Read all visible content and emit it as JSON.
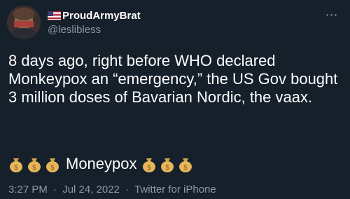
{
  "author": {
    "display_name": "ProudArmyBrat",
    "handle": "@leslibless",
    "flag_icon": "us-flag-icon"
  },
  "tweet": {
    "text": "8 days ago, right before WHO declared Monkeypox an “emergency,” the US Gov bought 3 million doses of Bavarian Nordic, the vaax.",
    "emoji_word": "Moneypox",
    "emoji_icon": "money-bag-icon",
    "emoji_count_before": 3,
    "emoji_count_after": 3
  },
  "meta": {
    "time": "3:27 PM",
    "separator": "·",
    "date": "Jul 24, 2022",
    "source": "Twitter for iPhone"
  },
  "colors": {
    "background": "#15202b",
    "text": "#ffffff",
    "secondary": "#8b98a5"
  }
}
